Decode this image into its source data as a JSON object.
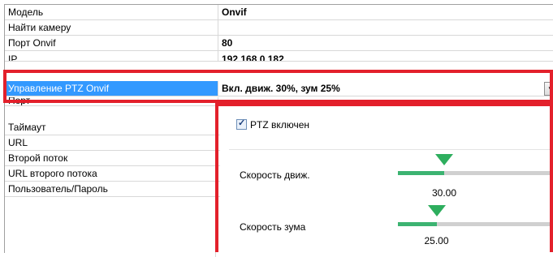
{
  "grid": {
    "rows": [
      {
        "name": "Модель",
        "value": "Onvif"
      },
      {
        "name": "Найти камеру",
        "value": ""
      },
      {
        "name": "Порт Onvif",
        "value": "80"
      },
      {
        "name": "IP",
        "value": "192.168.0.182"
      },
      {
        "name": "Управление PTZ Onvif",
        "value": "Вкл. движ. 30%, зум 25%"
      },
      {
        "name": "Порт",
        "value": ""
      },
      {
        "name": "Таймаут",
        "value": ""
      },
      {
        "name": "URL",
        "value": ""
      },
      {
        "name": "Второй поток",
        "value": ""
      },
      {
        "name": "URL второго потока",
        "value": ""
      },
      {
        "name": "Пользователь/Пароль",
        "value": ""
      }
    ],
    "dropdown_glyph": "▼"
  },
  "ptz_panel": {
    "enabled_label": "PTZ включен",
    "enabled": true,
    "check_glyph": "✓",
    "move_speed": {
      "label": "Скорость движ.",
      "value": 30,
      "display": "30.00"
    },
    "zoom_speed": {
      "label": "Скорость зума",
      "value": 25,
      "display": "25.00"
    }
  },
  "highlight_color": "#e3202b",
  "selection_color": "#3399ff"
}
